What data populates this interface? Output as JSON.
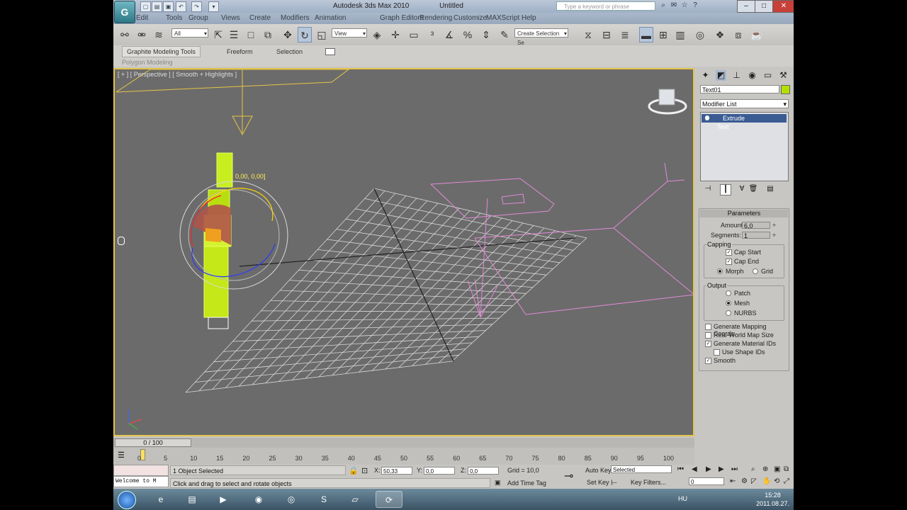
{
  "window": {
    "app_title": "Autodesk 3ds Max 2010",
    "doc_title": "Untitled",
    "search_placeholder": "Type a keyword or phrase",
    "logo_text": "G"
  },
  "menu": [
    "Edit",
    "Tools",
    "Group",
    "Views",
    "Create",
    "Modifiers",
    "Animation",
    "Graph Editors",
    "Rendering",
    "Customize",
    "MAXScript",
    "Help"
  ],
  "toolbar": {
    "selection_filter": "All",
    "ref_coord": "View",
    "named_selection": "Create Selection Se"
  },
  "ribbon": {
    "tabs": [
      "Graphite Modeling Tools",
      "Freeform",
      "Selection"
    ],
    "sub_label": "Polygon Modeling"
  },
  "viewport": {
    "label": "[ + ] [ Perspective ] [ Smooth + Highlights ]",
    "coord_tip": "0,00, 0,00]"
  },
  "command_panel": {
    "object_name": "Text01",
    "modifier_list": "Modifier List",
    "stack": [
      "Extrude",
      "Text"
    ],
    "parameters": {
      "title": "Parameters",
      "amount_label": "Amount:",
      "amount_value": "6,0",
      "segments_label": "Segments:",
      "segments_value": "1",
      "capping_title": "Capping",
      "cap_start": "Cap Start",
      "cap_end": "Cap End",
      "morph": "Morph",
      "grid": "Grid",
      "output_title": "Output",
      "patch": "Patch",
      "mesh": "Mesh",
      "nurbs": "NURBS",
      "gen_mapping": "Generate Mapping Coords.",
      "real_world": "Real-World Map Size",
      "gen_material": "Generate Material IDs",
      "use_shape": "Use Shape IDs",
      "smooth": "Smooth"
    }
  },
  "timeline": {
    "slider": "0 / 100",
    "ticks": [
      "0",
      "5",
      "10",
      "15",
      "20",
      "25",
      "30",
      "35",
      "40",
      "45",
      "50",
      "55",
      "60",
      "65",
      "70",
      "75",
      "80",
      "85",
      "90",
      "95",
      "100"
    ]
  },
  "status": {
    "listener": "Welcome to M",
    "selected": "1 Object Selected",
    "prompt": "Click and drag to select and rotate objects",
    "x_label": "X:",
    "x_value": "50,33",
    "y_label": "Y:",
    "y_value": "0,0",
    "z_label": "Z:",
    "z_value": "0,0",
    "grid": "Grid = 10,0",
    "add_time_tag": "Add Time Tag",
    "auto_key": "Auto Key",
    "auto_key_mode": "Selected",
    "set_key": "Set Key",
    "key_filters": "Key Filters...",
    "frame": "0"
  },
  "taskbar": {
    "lang": "HU",
    "time": "15:28",
    "date": "2011.08.27."
  }
}
